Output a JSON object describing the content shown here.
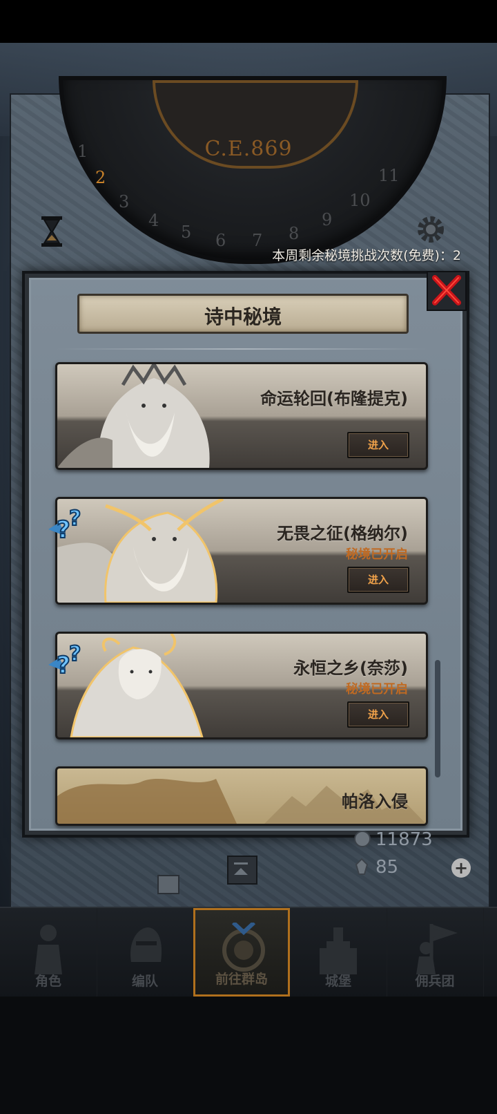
{
  "header": {
    "era": "C.E.869",
    "dial_numbers": [
      "1",
      "2",
      "3",
      "4",
      "5",
      "6",
      "7",
      "8",
      "9",
      "10",
      "11"
    ],
    "weekly_attempts": "本周剩余秘境挑战次数(免费)：2"
  },
  "panel": {
    "title": "诗中秘境",
    "cards": [
      {
        "name": "命运轮回(布隆提克)",
        "status": "",
        "button": "进入"
      },
      {
        "name": "无畏之征(格纳尔)",
        "status": "秘境已开启",
        "button": "进入"
      },
      {
        "name": "永恒之乡(奈莎)",
        "status": "秘境已开启",
        "button": "进入"
      },
      {
        "name": "帕洛入侵",
        "status": "",
        "button": ""
      }
    ]
  },
  "resources": {
    "silver": "11873",
    "crystal": "85"
  },
  "nav": {
    "items": [
      {
        "label": "角色",
        "icon": "knight-icon"
      },
      {
        "label": "编队",
        "icon": "helmet-icon"
      },
      {
        "label": "前往群岛",
        "icon": "compass-icon",
        "active": true
      },
      {
        "label": "城堡",
        "icon": "castle-icon"
      },
      {
        "label": "佣兵团",
        "icon": "mercenary-icon"
      }
    ]
  },
  "colors": {
    "accent_orange": "#f0a24a",
    "status_orange": "#c06a22",
    "close_red": "#c8141a",
    "active_nav_border": "#b0701d"
  }
}
